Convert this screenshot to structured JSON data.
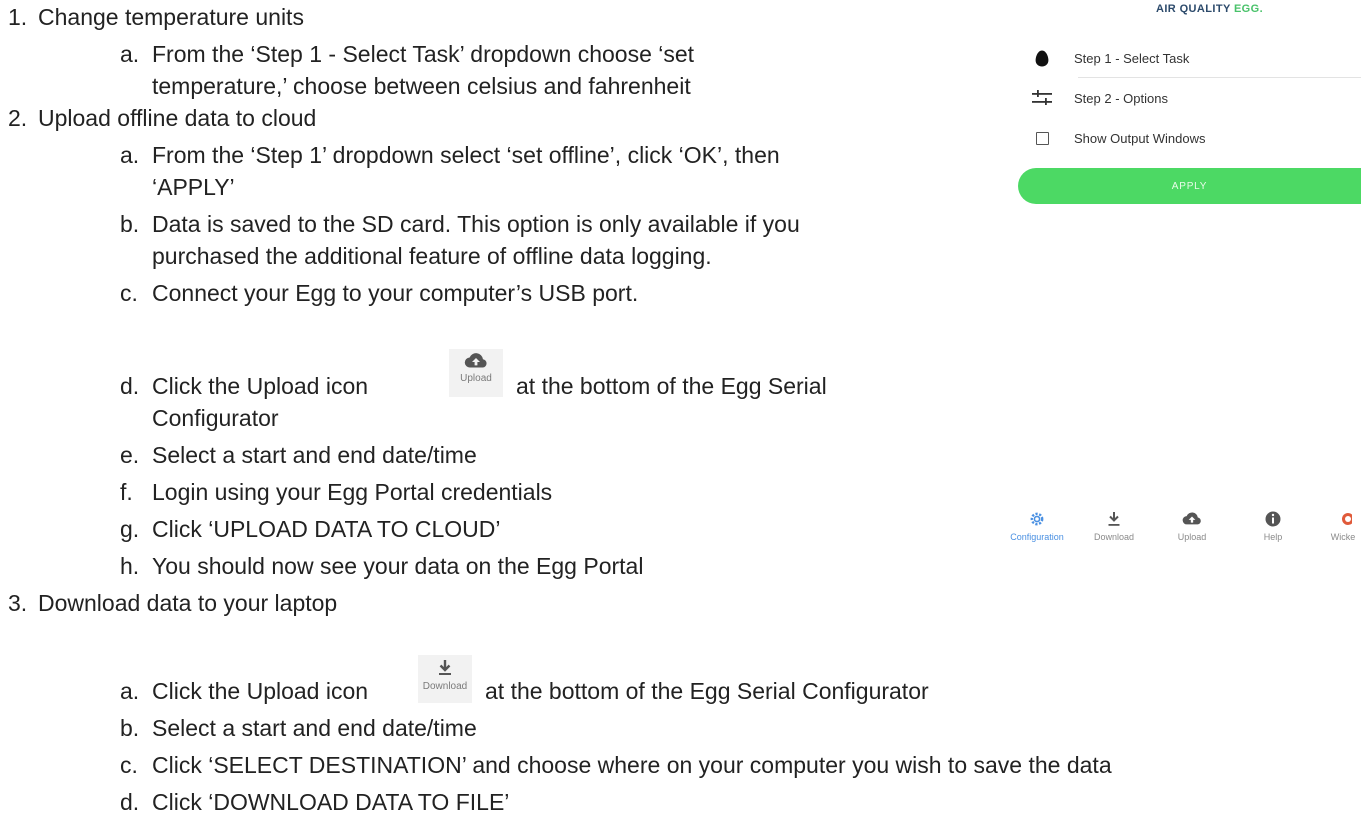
{
  "instructions": {
    "item1": {
      "num": "1.",
      "text": "Change temperature units"
    },
    "item1a": {
      "letter": "a.",
      "line1": "From the ‘Step 1 - Select Task’ dropdown choose ‘set",
      "line2": "temperature,’ choose between celsius and fahrenheit"
    },
    "item2": {
      "num": "2.",
      "text": "Upload offline data to cloud"
    },
    "item2a": {
      "letter": "a.",
      "line1": "From the ‘Step 1’ dropdown select ‘set offline’, click ‘OK’, then",
      "line2": "‘APPLY’"
    },
    "item2b": {
      "letter": "b.",
      "line1": "Data is saved to the SD card. This option is only available if you",
      "line2": "purchased the additional feature of offline data logging."
    },
    "item2c": {
      "letter": "c.",
      "text": "Connect your Egg to your computer’s USB port."
    },
    "item2d": {
      "letter": "d.",
      "before": "Click the Upload icon",
      "icon_label": "Upload",
      "icon": "cloud-upload-icon",
      "after": "at the bottom of the Egg Serial",
      "line2": "Configurator"
    },
    "item2e": {
      "letter": "e.",
      "text": "Select a start and end date/time"
    },
    "item2f": {
      "letter": "f.",
      "text": "Login using your Egg Portal credentials"
    },
    "item2g": {
      "letter": "g.",
      "text": "Click ‘UPLOAD DATA TO CLOUD’"
    },
    "item2h": {
      "letter": "h.",
      "text": "You should now see your data on the Egg Portal"
    },
    "item3": {
      "num": "3.",
      "text": "Download data to your laptop"
    },
    "item3a": {
      "letter": "a.",
      "before": "Click the Upload icon",
      "icon_label": "Download",
      "icon": "download-icon",
      "after": "at the bottom of the Egg Serial Configurator"
    },
    "item3b": {
      "letter": "b.",
      "text": "Select a start and end date/time"
    },
    "item3c": {
      "letter": "c.",
      "text": "Click ‘SELECT DESTINATION’ and choose where on your computer you wish to save the data"
    },
    "item3d": {
      "letter": "d.",
      "text": "Click ‘DOWNLOAD DATA TO FILE’"
    }
  },
  "app": {
    "brand_part1": "AIR QUALITY ",
    "brand_part2": "EGG",
    "brand_dot": ".",
    "step1_label": "Step 1 - Select Task",
    "step2_label": "Step 2 - Options",
    "show_output_label": "Show Output Windows",
    "apply_label": "APPLY",
    "tabs": [
      {
        "label": "Configuration",
        "icon": "gear-icon"
      },
      {
        "label": "Download",
        "icon": "download-icon"
      },
      {
        "label": "Upload",
        "icon": "cloud-upload-icon"
      },
      {
        "label": "Help",
        "icon": "info-icon"
      },
      {
        "label": "Wicke",
        "icon": "wicked-logo-icon"
      }
    ]
  },
  "colors": {
    "accent_green": "#4cd964",
    "active_tab_blue": "#4a90e2",
    "brand_navy": "#2c4a6b"
  }
}
